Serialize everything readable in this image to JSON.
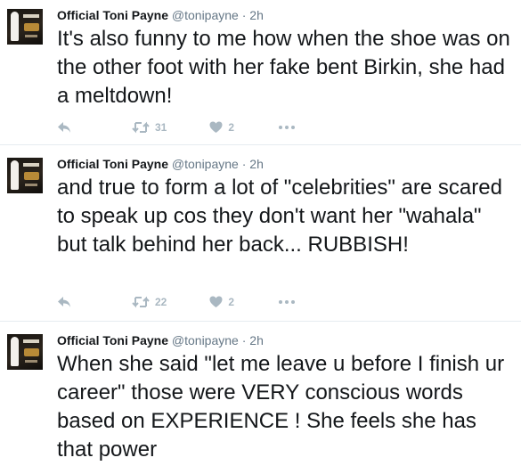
{
  "tweets": [
    {
      "name": "Official Toni Payne",
      "handle": "@tonipayne",
      "separator": "·",
      "time": "2h",
      "text": "It's also funny to me how when the shoe was on the other foot with her fake bent Birkin, she had a meltdown!",
      "retweets": "31",
      "likes": "2"
    },
    {
      "name": "Official Toni Payne",
      "handle": "@tonipayne",
      "separator": "·",
      "time": "2h",
      "text": "and true to form a lot of \"celebrities\" are scared to speak up cos they don't want her \"wahala\" but talk behind her back... RUBBISH!",
      "retweets": "22",
      "likes": "2"
    },
    {
      "name": "Official Toni Payne",
      "handle": "@tonipayne",
      "separator": "·",
      "time": "2h",
      "text": "When she said \"let me leave u before I finish ur career\" those were VERY conscious words based on EXPERIENCE ! She feels she has that power"
    }
  ],
  "icons": [
    "reply-icon",
    "retweet-icon",
    "heart-icon",
    "more-icon"
  ]
}
